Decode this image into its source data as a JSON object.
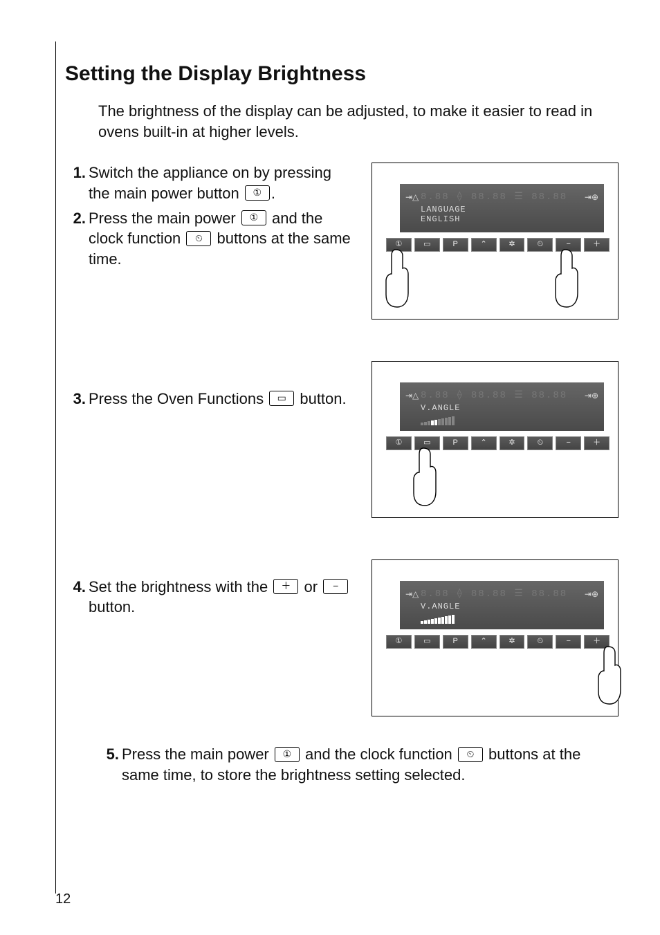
{
  "pageNumber": "12",
  "title": "Setting the Display Brightness",
  "intro": "The brightness of the display can be adjusted, to make it easier to read in ovens built-in at higher levels.",
  "icons": {
    "power": "①",
    "clock": "⏲",
    "oven": "▭",
    "plus": "＋",
    "minus": "−",
    "p": "P",
    "nav": "⌃",
    "sun": "✲"
  },
  "steps": {
    "s1": {
      "num": "1.",
      "text_a": "Switch the appliance on by pressing the main power button ",
      "text_b": "."
    },
    "s2": {
      "num": "2.",
      "text_a": "Press the main power ",
      "text_b": " and the clock function ",
      "text_c": " buttons at the same time."
    },
    "s3": {
      "num": "3.",
      "text_a": "Press the Oven Functions ",
      "text_b": " button."
    },
    "s4": {
      "num": "4.",
      "text_a": "Set the brightness with the ",
      "text_b": " or ",
      "text_c": " button."
    },
    "s5": {
      "num": "5.",
      "text_a": "Press the main power ",
      "text_b": " and the clock function ",
      "text_c": " buttons at the same time, to store the brightness setting selected."
    }
  },
  "figures": {
    "f1": {
      "line1": "LANGUAGE",
      "line2": "ENGLISH",
      "ghost": "8.88 ⟠ 88.88 ☰ 88.88"
    },
    "f2": {
      "line1": "V.ANGLE",
      "line2": "",
      "ghost": "8.88 ⟠ 88.88 ☰ 88.88"
    },
    "f3": {
      "line1": "V.ANGLE",
      "line2": "",
      "ghost": "8.88 ⟠ 88.88 ☰ 88.88"
    }
  }
}
